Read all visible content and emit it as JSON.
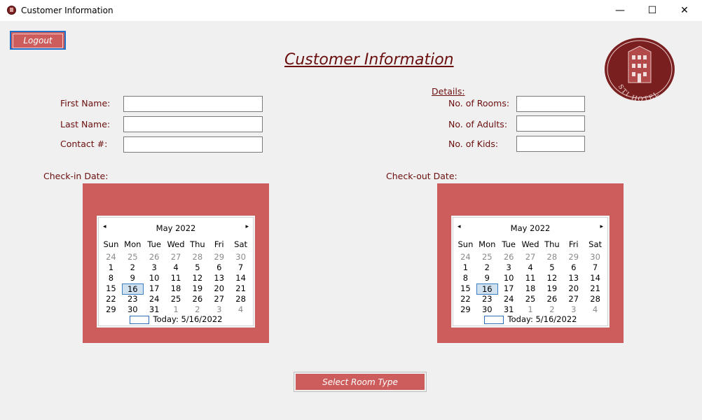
{
  "window": {
    "title": "Customer Information",
    "minimize": "—",
    "maximize": "☐",
    "close": "✕"
  },
  "toolbar": {
    "logout_label": "Logout"
  },
  "heading": "Customer Information",
  "logo": {
    "text": "STI HOTEL"
  },
  "customer_form": {
    "first_name_label": "First Name:",
    "last_name_label": "Last Name:",
    "contact_label": "Contact #:",
    "first_name_value": "",
    "last_name_value": "",
    "contact_value": ""
  },
  "details": {
    "title": "Details:",
    "rooms_label": "No. of Rooms:",
    "adults_label": "No. of Adults:",
    "kids_label": "No. of Kids:",
    "rooms_value": "",
    "adults_value": "",
    "kids_value": ""
  },
  "checkin": {
    "label": "Check-in Date:",
    "calendar": {
      "month": "May 2022",
      "prev": "◂",
      "next": "▸",
      "dow": [
        "Sun",
        "Mon",
        "Tue",
        "Wed",
        "Thu",
        "Fri",
        "Sat"
      ],
      "weeks": [
        [
          "24",
          "25",
          "26",
          "27",
          "28",
          "29",
          "30"
        ],
        [
          "1",
          "2",
          "3",
          "4",
          "5",
          "6",
          "7"
        ],
        [
          "8",
          "9",
          "10",
          "11",
          "12",
          "13",
          "14"
        ],
        [
          "15",
          "16",
          "17",
          "18",
          "19",
          "20",
          "21"
        ],
        [
          "22",
          "23",
          "24",
          "25",
          "26",
          "27",
          "28"
        ],
        [
          "29",
          "30",
          "31",
          "1",
          "2",
          "3",
          "4"
        ]
      ],
      "selected": "16",
      "today": "Today: 5/16/2022"
    }
  },
  "checkout": {
    "label": "Check-out Date:",
    "calendar": {
      "month": "May 2022",
      "prev": "◂",
      "next": "▸",
      "dow": [
        "Sun",
        "Mon",
        "Tue",
        "Wed",
        "Thu",
        "Fri",
        "Sat"
      ],
      "weeks": [
        [
          "24",
          "25",
          "26",
          "27",
          "28",
          "29",
          "30"
        ],
        [
          "1",
          "2",
          "3",
          "4",
          "5",
          "6",
          "7"
        ],
        [
          "8",
          "9",
          "10",
          "11",
          "12",
          "13",
          "14"
        ],
        [
          "15",
          "16",
          "17",
          "18",
          "19",
          "20",
          "21"
        ],
        [
          "22",
          "23",
          "24",
          "25",
          "26",
          "27",
          "28"
        ],
        [
          "29",
          "30",
          "31",
          "1",
          "2",
          "3",
          "4"
        ]
      ],
      "selected": "16",
      "today": "Today: 5/16/2022"
    }
  },
  "actions": {
    "select_room_label": "Select Room Type"
  },
  "colors": {
    "accent": "#cd5c5c",
    "text": "#6b0e0e",
    "logo": "#7a1f1f"
  }
}
